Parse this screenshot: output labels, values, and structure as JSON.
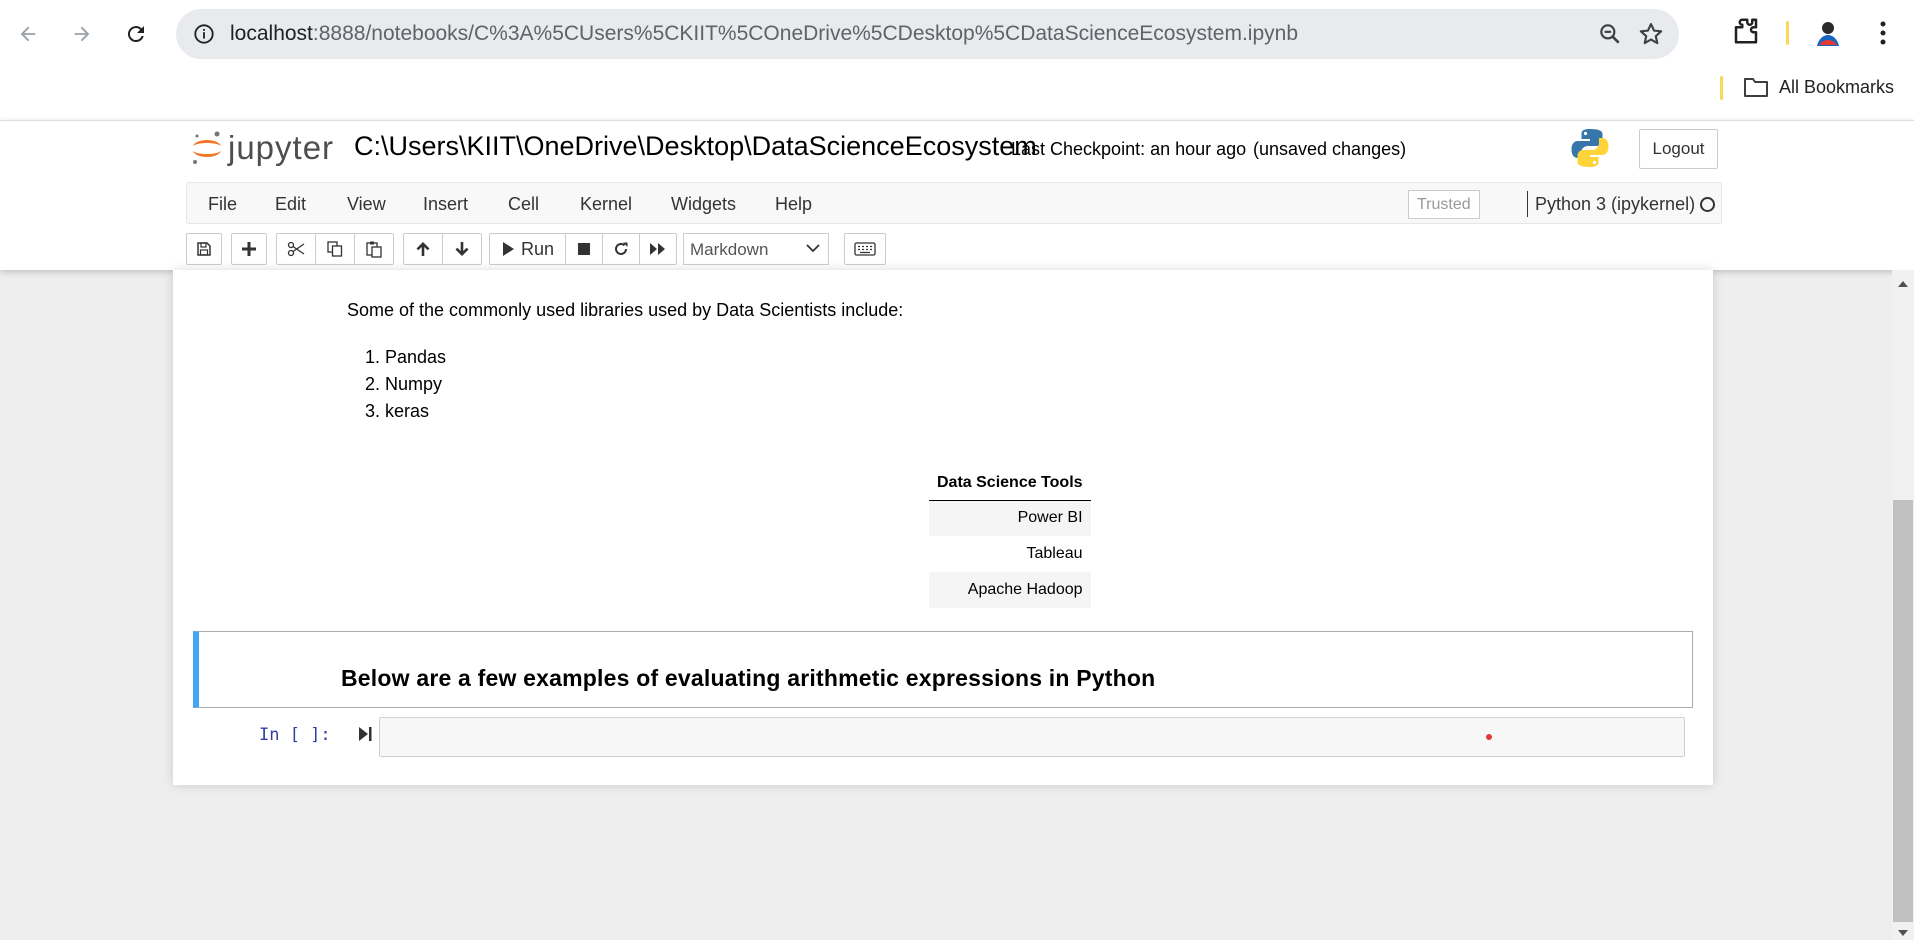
{
  "browser": {
    "url_host": "localhost",
    "url_rest": ":8888/notebooks/C%3A%5CUsers%5CKIIT%5COneDrive%5CDesktop%5CDataScienceEcosystem.ipynb",
    "bookmarks_label": "All Bookmarks"
  },
  "header": {
    "logo_text": "jupyter",
    "notebook_title": "C:\\Users\\KIIT\\OneDrive\\Desktop\\DataScienceEcosystem",
    "checkpoint": "Last Checkpoint: an hour ago",
    "unsaved": "(unsaved changes)",
    "logout_label": "Logout"
  },
  "menu": {
    "items": [
      "File",
      "Edit",
      "View",
      "Insert",
      "Cell",
      "Kernel",
      "Widgets",
      "Help"
    ],
    "trusted_label": "Trusted",
    "kernel_name": "Python 3 (ipykernel)"
  },
  "toolbar": {
    "run_label": "Run",
    "cell_type": "Markdown"
  },
  "notebook": {
    "libraries_intro": "Some of the commonly used libraries used by Data Scientists include:",
    "libraries": [
      "Pandas",
      "Numpy",
      "keras"
    ],
    "table_header": "Data Science Tools",
    "tools": [
      "Power BI",
      "Tableau",
      "Apache Hadoop"
    ],
    "selected_heading": "Below are a few examples of evaluating arithmetic expressions in Python",
    "code_prompt": "In [ ]:"
  },
  "colors": {
    "selected_cell_border": "#42a5f5",
    "prompt_color": "#303f9f",
    "jupyter_orange": "#f37726"
  }
}
